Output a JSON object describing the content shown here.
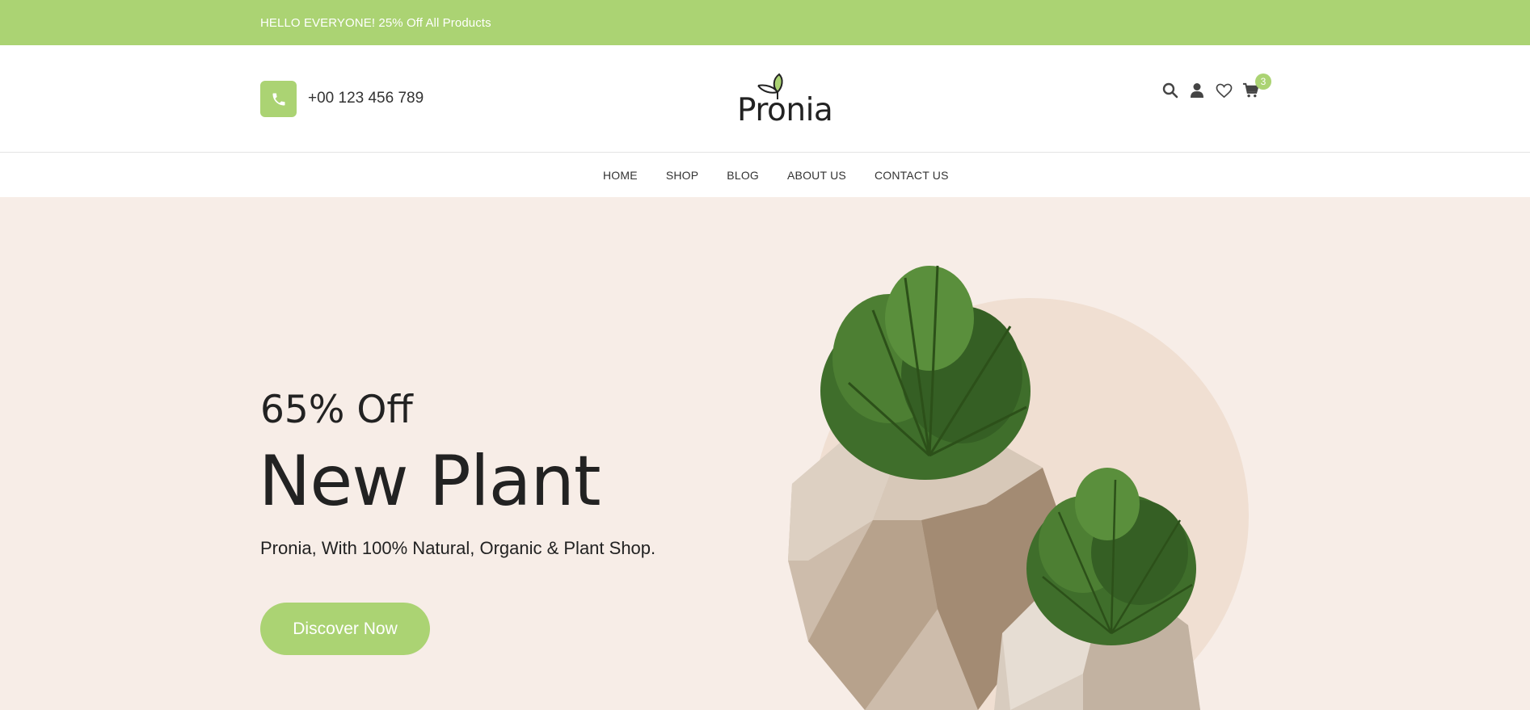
{
  "promo": {
    "text": "HELLO EVERYONE! 25% Off All Products"
  },
  "header": {
    "phone": "+00 123 456 789",
    "logo_text": "Pronia",
    "cart_count": "3",
    "icons": [
      "search-icon",
      "user-icon",
      "heart-icon",
      "cart-icon",
      "phone-icon"
    ]
  },
  "nav": {
    "items": [
      {
        "label": "HOME"
      },
      {
        "label": "SHOP"
      },
      {
        "label": "BLOG"
      },
      {
        "label": "ABOUT US"
      },
      {
        "label": "CONTACT US"
      }
    ]
  },
  "hero": {
    "subtitle": "65% Off",
    "title": "New Plant",
    "description": "Pronia, With 100% Natural, Organic & Plant Shop.",
    "button_label": "Discover Now"
  },
  "colors": {
    "accent": "#abd373",
    "hero_bg": "#f7ede7",
    "text_dark": "#222222"
  }
}
